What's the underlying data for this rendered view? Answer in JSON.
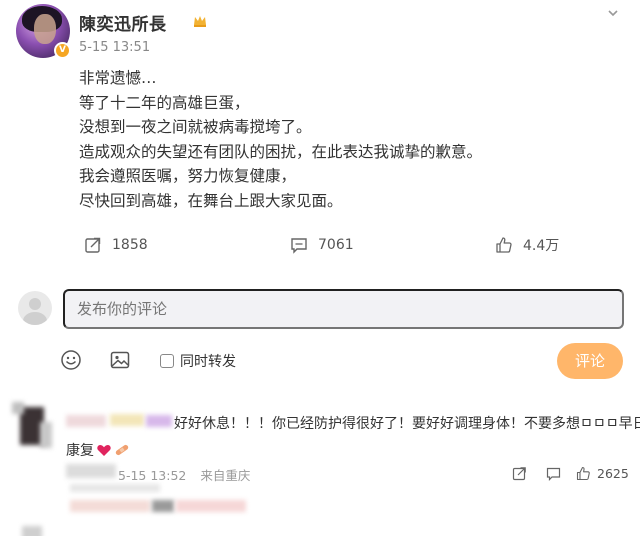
{
  "post": {
    "username": "陳奕迅所長",
    "timestamp": "5-15 13:51",
    "lines": [
      "非常遗憾…",
      "等了十二年的高雄巨蛋，",
      "没想到一夜之间就被病毒搅垮了。",
      "造成观众的失望还有团队的困扰，在此表达我诚挚的歉意。",
      "我会遵照医嘱，努力恢复健康，",
      "尽快回到高雄，在舞台上跟大家见面。"
    ],
    "reposts": "1858",
    "comments": "7061",
    "likes": "4.4万"
  },
  "composer": {
    "placeholder": "发布你的评论",
    "repost_label": "同时转发",
    "submit_label": "评论"
  },
  "reply": {
    "text_line1": "好好休息！！！你已经防护得很好了！要好好调理身体！不要多想ㅁㅁㅁ早日",
    "text_line2": "康复",
    "time": "5-15 13:52",
    "source": "来自重庆",
    "likes": "2625"
  },
  "colors": {
    "accent": "#ff8200",
    "submit_bg": "#ffb66a",
    "input_bg": "#f2f2f5",
    "heart": "#e0245e"
  }
}
